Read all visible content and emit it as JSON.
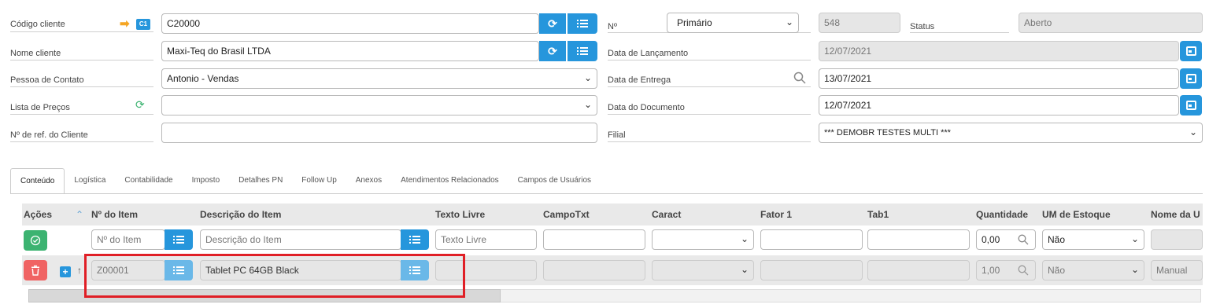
{
  "header": {
    "codigo_cliente": {
      "label": "Código cliente",
      "value": "C20000",
      "badge": "C1"
    },
    "nome_cliente": {
      "label": "Nome cliente",
      "value": "Maxi-Teq do Brasil LTDA"
    },
    "pessoa_contato": {
      "label": "Pessoa de Contato",
      "value": "Antonio - Vendas"
    },
    "lista_precos": {
      "label": "Lista de Preços",
      "value": ""
    },
    "ref_cliente": {
      "label": "Nº de ref. do Cliente",
      "value": ""
    },
    "numero": {
      "label": "Nº",
      "series": "Primário",
      "value": "548"
    },
    "status": {
      "label": "Status",
      "value": "Aberto"
    },
    "data_lancamento": {
      "label": "Data de Lançamento",
      "value": "12/07/2021"
    },
    "data_entrega": {
      "label": "Data de Entrega",
      "value": "13/07/2021"
    },
    "data_documento": {
      "label": "Data do Documento",
      "value": "12/07/2021"
    },
    "filial": {
      "label": "Filial",
      "value": "*** DEMOBR TESTES MULTI ***"
    }
  },
  "tabs": [
    {
      "label": "Conteúdo",
      "active": true
    },
    {
      "label": "Logística"
    },
    {
      "label": "Contabilidade"
    },
    {
      "label": "Imposto"
    },
    {
      "label": "Detalhes PN"
    },
    {
      "label": "Follow Up"
    },
    {
      "label": "Anexos"
    },
    {
      "label": "Atendimentos Relacionados"
    },
    {
      "label": "Campos de Usuários"
    }
  ],
  "grid": {
    "columns": [
      "Ações",
      "Nº do Item",
      "Descrição do Item",
      "Texto Livre",
      "CampoTxt",
      "Caract",
      "Fator 1",
      "Tab1",
      "Quantidade",
      "UM de Estoque",
      "Nome da U"
    ],
    "new_row": {
      "item_placeholder": "Nº do Item",
      "desc_placeholder": "Descrição do Item",
      "texto_placeholder": "Texto Livre",
      "quantidade": "0,00",
      "um_estoque": "Não"
    },
    "rows": [
      {
        "item": "Z00001",
        "descricao": "Tablet PC 64GB Black",
        "quantidade": "1,00",
        "um_estoque": "Não",
        "nome_u": "Manual"
      }
    ]
  },
  "colors": {
    "accent": "#2696dc",
    "success": "#3cb371",
    "danger": "#f06363",
    "arrow": "#f5a623",
    "highlight": "#e01f26"
  }
}
